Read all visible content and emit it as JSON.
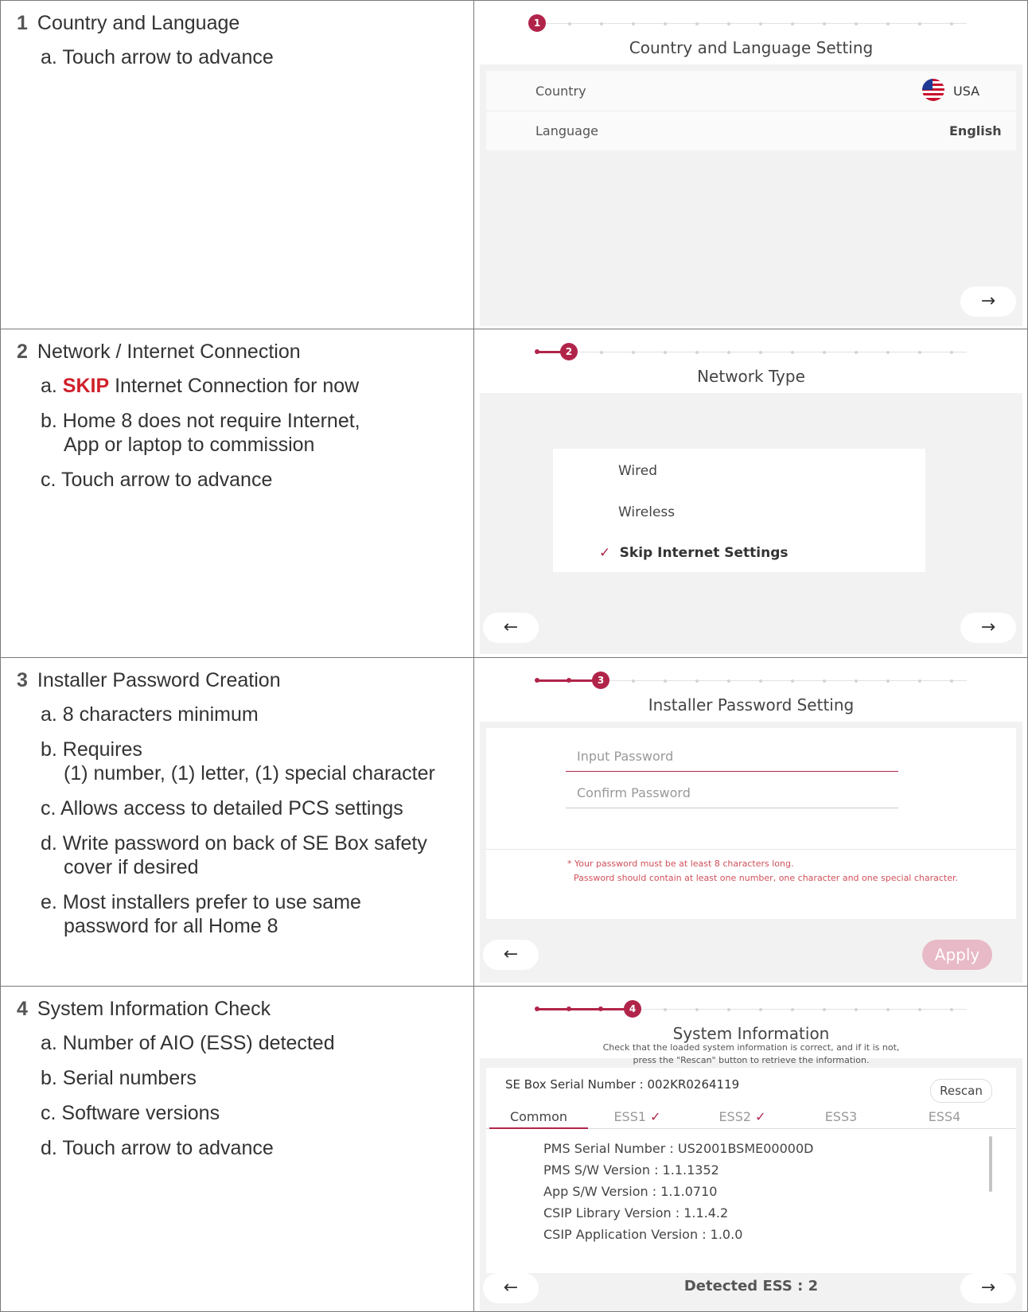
{
  "steps": [
    {
      "number": "1",
      "title": "Country and Language",
      "instructions": [
        "a. Touch arrow to advance"
      ],
      "screen": {
        "title": "Country and Language Setting",
        "active_step": "1",
        "country_label": "Country",
        "country_value": "USA",
        "language_label": "Language",
        "language_value": "English",
        "next_icon": "→"
      }
    },
    {
      "number": "2",
      "title": "Network / Internet Connection",
      "instructions": {
        "a_prefix": "a. ",
        "a_skip": "SKIP",
        "a_rest": " Internet Connection for now",
        "b_line1": "b. Home 8 does not require Internet,",
        "b_line2": "App or laptop to commission",
        "c": "c. Touch arrow to advance"
      },
      "screen": {
        "title": "Network Type",
        "active_step": "2",
        "options": [
          "Wired",
          "Wireless",
          "Skip Internet Settings"
        ],
        "check_icon": "✓",
        "back_icon": "←",
        "next_icon": "→"
      }
    },
    {
      "number": "3",
      "title": "Installer Password Creation",
      "instructions": {
        "a": "a. 8 characters minimum",
        "b_line1": "b. Requires",
        "b_line2": "(1) number, (1) letter, (1) special character",
        "c": "c. Allows access to detailed PCS settings",
        "d_line1": "d. Write password on back of SE Box safety",
        "d_line2": "cover if desired",
        "e_line1": "e. Most installers prefer to use same",
        "e_line2": "password for all Home 8"
      },
      "screen": {
        "title": "Installer Password Setting",
        "active_step": "3",
        "input_placeholder": "Input Password",
        "confirm_placeholder": "Confirm Password",
        "note_line1": "* Your password must be at least 8 characters long.",
        "note_line2": "Password should contain at least one number, one character and one special character.",
        "back_icon": "←",
        "apply_label": "Apply"
      }
    },
    {
      "number": "4",
      "title": "System Information Check",
      "instructions": {
        "a": "a. Number of AIO (ESS) detected",
        "b": "b. Serial numbers",
        "c": "c. Software versions",
        "d": "d. Touch arrow to advance"
      },
      "screen": {
        "title": "System Information",
        "active_step": "4",
        "subtitle_line1": "Check that the loaded system information is correct, and if it is not,",
        "subtitle_line2": "press the \"Rescan\" button to retrieve the information.",
        "se_box_serial": "SE Box Serial Number : 002KR0264119",
        "rescan_label": "Rescan",
        "tabs": [
          "Common",
          "ESS1",
          "ESS2",
          "ESS3",
          "ESS4"
        ],
        "check_icon": "✓",
        "info_lines": [
          "PMS Serial Number : US2001BSME00000D",
          "PMS S/W Version : 1.1.1352",
          "App S/W Version : 1.1.0710",
          "CSIP Library Version : 1.1.4.2",
          "CSIP Application Version : 1.0.0"
        ],
        "detected_ess": "Detected ESS : 2",
        "back_icon": "←",
        "next_icon": "→"
      }
    }
  ],
  "colors": {
    "accent": "#b1244a",
    "skip_red": "#d0202a",
    "screen_bg": "#f2f2f2",
    "apply_disabled": "#e8b9c6"
  }
}
